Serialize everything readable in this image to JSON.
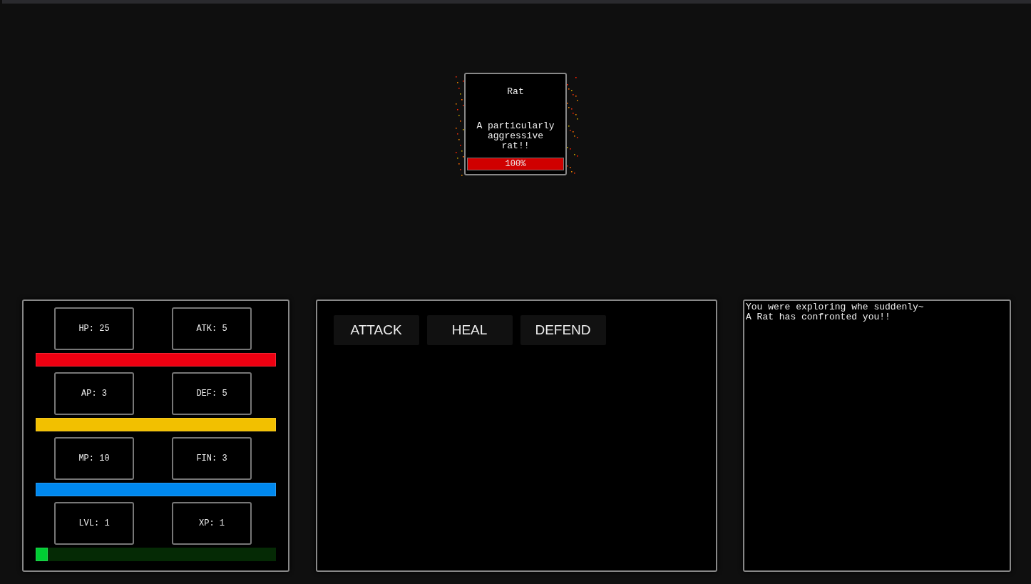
{
  "enemy": {
    "name": "Rat",
    "description": "A particularly aggressive rat!!",
    "health": {
      "level": 1,
      "reading": "100%"
    }
  },
  "stats": [
    {
      "cells": [
        "HP: 25",
        "ATK: 5"
      ],
      "bar": {
        "level": 1,
        "color": "#ee0011"
      }
    },
    {
      "cells": [
        "AP: 3",
        "DEF: 5"
      ],
      "bar": {
        "level": 1,
        "color": "#f2c000"
      }
    },
    {
      "cells": [
        "MP: 10",
        "FIN: 3"
      ],
      "bar": {
        "level": 1,
        "color": "#0088ee"
      }
    },
    {
      "cells": [
        "LVL: 1",
        "XP: 1"
      ],
      "bar": {
        "level": 0.05,
        "color": "#00cc33"
      }
    }
  ],
  "actions": [
    "ATTACK",
    "HEAL",
    "DEFEND"
  ],
  "log": [
    "You were exploring whe suddenly~",
    "A Rat has confronted you!!"
  ]
}
